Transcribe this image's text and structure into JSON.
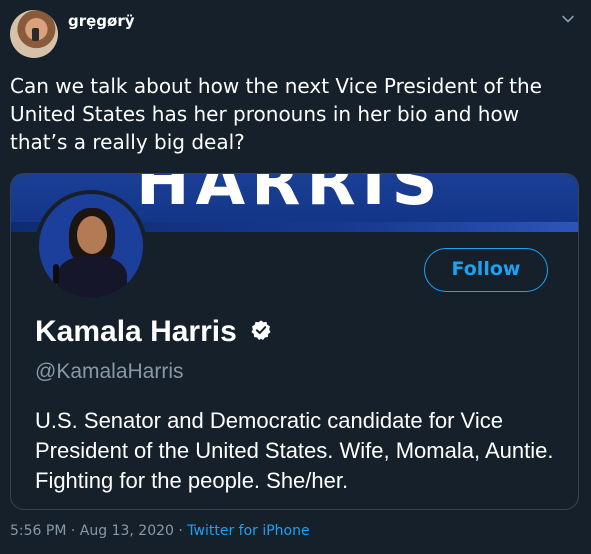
{
  "author": {
    "username": "grȩgørÿ"
  },
  "tweet": {
    "text": "Can we talk about how the next Vice President of the United States has her pronouns in her bio and how that’s a really big deal?"
  },
  "card": {
    "banner_text": "HARRIS",
    "follow_label": "Follow",
    "display_name": "Kamala Harris",
    "handle": "@KamalaHarris",
    "bio": "U.S. Senator and Democratic candidate for Vice President of the United States. Wife, Momala, Auntie. Fighting for the people. She/her.",
    "verified_icon": "verified-badge-icon"
  },
  "meta": {
    "time": "5:56 PM",
    "sep1": " · ",
    "date": "Aug 13, 2020",
    "sep2": " · ",
    "source": "Twitter for iPhone"
  },
  "colors": {
    "background": "#15202b",
    "accent": "#1da1f2",
    "muted": "#8899a6",
    "banner": "#1a3f94"
  }
}
